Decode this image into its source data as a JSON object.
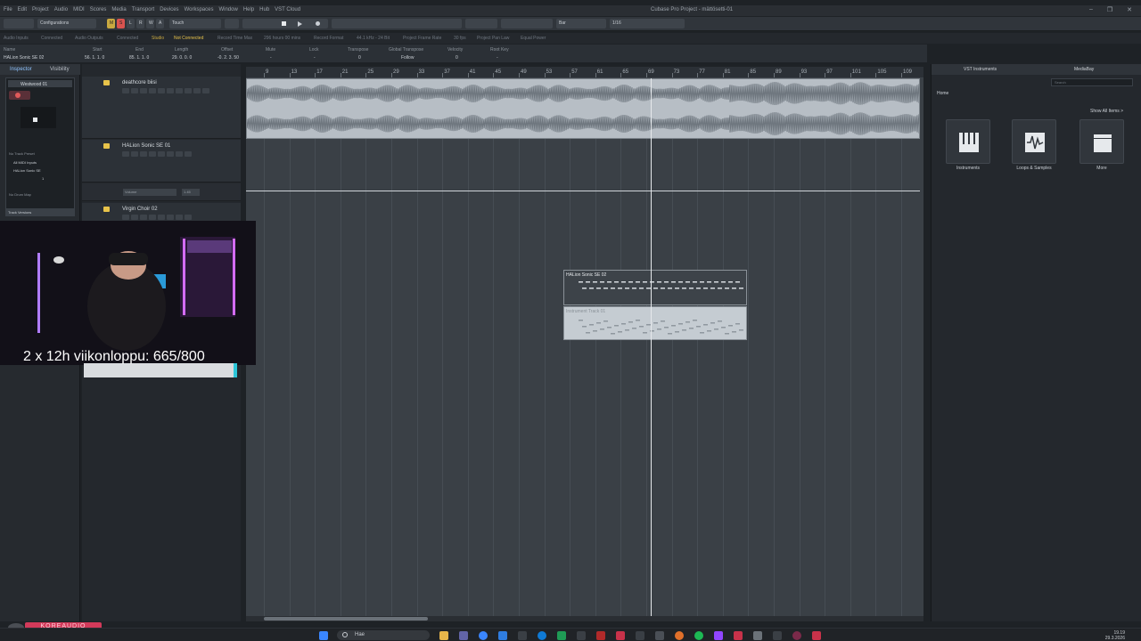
{
  "titlebar": {
    "menus": [
      "File",
      "Edit",
      "Project",
      "Audio",
      "MIDI",
      "Scores",
      "Media",
      "Transport",
      "Devices",
      "Workspaces",
      "Window",
      "Help",
      "Hub",
      "VST Cloud"
    ],
    "title": "Cubase Pro Project - mättösetti-01",
    "controls": [
      "–",
      "❐",
      "✕"
    ]
  },
  "toolbar": {
    "configurations": "Configurations",
    "touch_mode": "Touch",
    "snap_type": "Bar",
    "quantize": "1/16",
    "mode_letters": [
      "M",
      "S",
      "L",
      "R",
      "W",
      "A"
    ]
  },
  "statusline": {
    "items": [
      "Audio Inputs",
      "Connected",
      "Audio Outputs",
      "Connected",
      "Studio",
      "Not Connected",
      "Record Time Max",
      "296 hours 00 mins",
      "Record Format",
      "44.1 kHz - 24 Bit",
      "Project Frame Rate",
      "30 fps",
      "Project Pan Law",
      "Equal Power"
    ]
  },
  "infoline": {
    "labels": [
      "Name",
      "Start",
      "End",
      "Length",
      "Offset",
      "Mute",
      "Lock",
      "Transpose",
      "Global Transpose",
      "Velocity",
      "Root Key"
    ],
    "values": [
      "HALion Sonic SE 02",
      "56. 1. 1. 0",
      "85. 1. 1. 0",
      "29. 0. 0. 0",
      "-0. 2. 3. 50",
      "-",
      "-",
      "0",
      "Follow",
      "0",
      "-"
    ]
  },
  "inspector": {
    "tabs": [
      "Inspector",
      "Visibility"
    ],
    "track_name": "Westwood 01",
    "routing": [
      "No Track Preset",
      "All MIDI Inputs",
      "HALion Sonic SE",
      "No Drum Map"
    ],
    "channel": "1",
    "versions": "Track Versions"
  },
  "tracks": [
    {
      "name": "deathcore biisi"
    },
    {
      "name": "HALion Sonic SE 01"
    },
    {
      "name": "Virgin Choir 02"
    }
  ],
  "automation_lane": {
    "label": "Volume",
    "value": "1.45"
  },
  "ruler": {
    "bars": [
      "9",
      "13",
      "17",
      "21",
      "25",
      "29",
      "33",
      "37",
      "41",
      "45",
      "49",
      "53",
      "57",
      "61",
      "65",
      "69",
      "73",
      "77",
      "81",
      "85",
      "89",
      "93",
      "97",
      "101",
      "105",
      "109"
    ]
  },
  "events": {
    "midi_1": "HALion Sonic SE 02",
    "midi_2": "Instrument Track 01"
  },
  "rightzone": {
    "tabs": [
      "VST Instruments",
      "MediaBay"
    ],
    "search_placeholder": "Search",
    "home": "Home",
    "show_all": "Show All Items >",
    "tiles": [
      "Instruments",
      "Loops & Samples",
      "More"
    ]
  },
  "overlay": {
    "stream_text": "2 x 12h viikonloppu: 665/800",
    "logo_text": "KOREAUDIO"
  },
  "taskbar": {
    "search": "Hae",
    "time": "19.19",
    "date": "29.3.2026"
  },
  "colors": {
    "accent_yellow": "#e8c34a",
    "record_red": "#d23a5a",
    "cyan": "#2cc6d8"
  }
}
